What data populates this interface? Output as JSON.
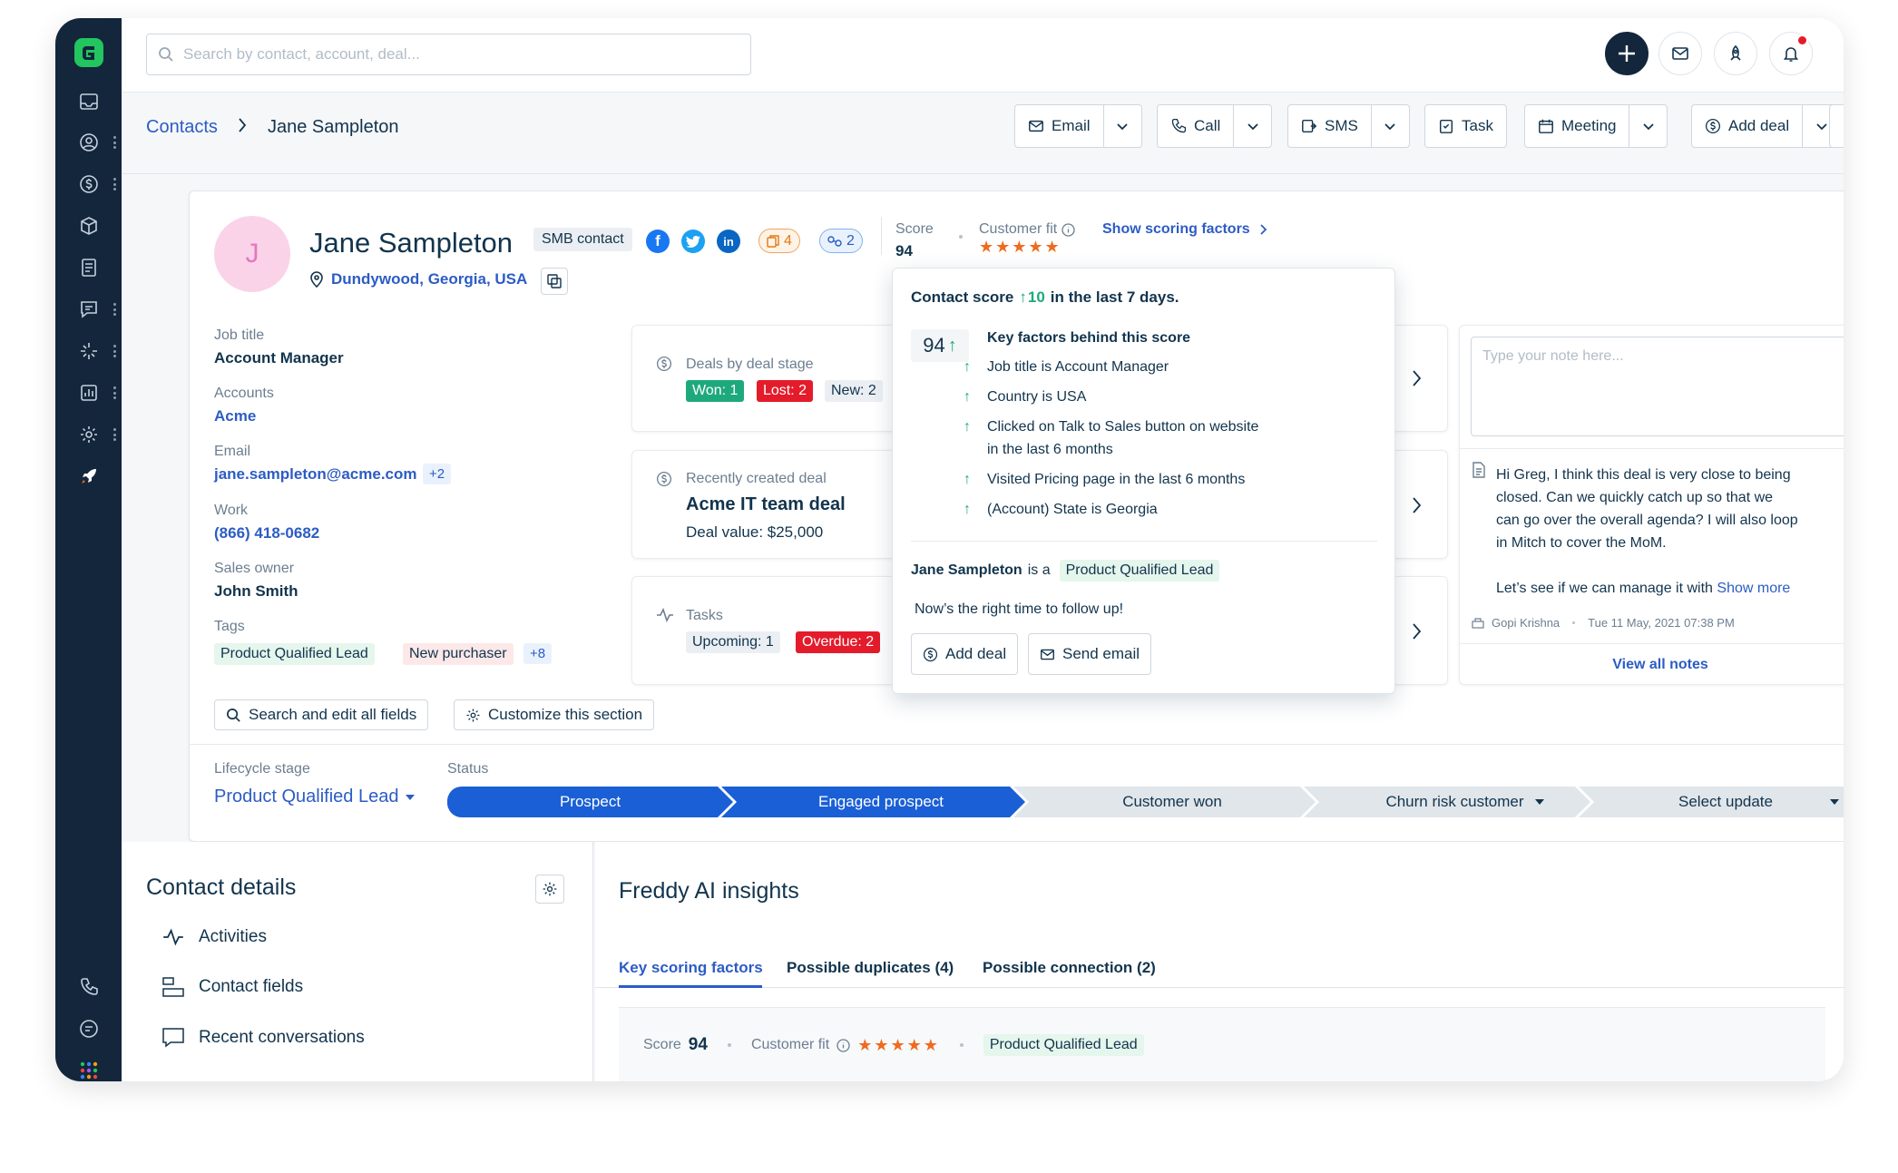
{
  "search": {
    "placeholder": "Search by contact, account, deal..."
  },
  "breadcrumb": {
    "parent": "Contacts",
    "current": "Jane Sampleton"
  },
  "actions": {
    "email": "Email",
    "call": "Call",
    "sms": "SMS",
    "task": "Task",
    "meeting": "Meeting",
    "add_deal": "Add deal"
  },
  "contact": {
    "initial": "J",
    "name": "Jane Sampleton",
    "type_badge": "SMB contact",
    "location": "Dundywood, Georgia, USA",
    "badge_files": "4",
    "badge_links": "2",
    "score_label": "Score",
    "score": "94",
    "fit_label": "Customer fit",
    "show_scoring": "Show scoring factors",
    "job_title_label": "Job title",
    "job_title": "Account Manager",
    "accounts_label": "Accounts",
    "account": "Acme",
    "email_label": "Email",
    "email": "jane.sampleton@acme.com",
    "email_more": "+2",
    "work_label": "Work",
    "work": "(866) 418-0682",
    "owner_label": "Sales owner",
    "owner": "John Smith",
    "tags_label": "Tags",
    "tags": [
      "Product Qualified Lead",
      "New purchaser"
    ],
    "tags_more": "+8",
    "search_fields": "Search and edit all fields",
    "customize": "Customize this section"
  },
  "deals_stage": {
    "label": "Deals by deal stage",
    "won": "Won: 1",
    "lost": "Lost: 2",
    "new": "New: 2"
  },
  "recent_deal": {
    "label": "Recently created deal",
    "name": "Acme IT team deal",
    "value": "Deal value: $25,000"
  },
  "tasks": {
    "label": "Tasks",
    "upcoming": "Upcoming: 1",
    "overdue": "Overdue: 2"
  },
  "popup": {
    "heading_pre": "Contact score",
    "heading_delta": "10",
    "heading_post": "in the last 7 days.",
    "score": "94",
    "factors_title": "Key factors behind this score",
    "factors": [
      "Job title is Account Manager",
      "Country is USA",
      "Clicked on Talk to Sales button on website",
      "in the last 6 months",
      "Visited Pricing page in the last 6 months",
      "(Account) State is Georgia"
    ],
    "lead_pre": "Jane Sampleton",
    "lead_mid": "is a",
    "lead_tag": "Product Qualified Lead",
    "advice": "Now’s the right time to follow up!",
    "add_deal": "Add deal",
    "send_email": "Send email"
  },
  "notes": {
    "placeholder": "Type your note here...",
    "lines": [
      "Hi Greg, I think this deal is very close to being",
      "closed. Can we quickly catch up so that we",
      "can go over the overall agenda? I will also loop",
      "in Mitch to cover the MoM."
    ],
    "line5": "Let’s see if we can manage it with",
    "show_more": "Show more",
    "author": "Gopi Krishna",
    "time": "Tue 11 May, 2021 07:38 PM",
    "view_all": "View all notes"
  },
  "lifecycle": {
    "label": "Lifecycle stage",
    "value": "Product Qualified Lead",
    "status_label": "Status",
    "stages": [
      "Prospect",
      "Engaged prospect",
      "Customer won",
      "Churn risk customer",
      "Select update"
    ]
  },
  "details": {
    "title": "Contact details",
    "items": [
      "Activities",
      "Contact fields",
      "Recent conversations"
    ]
  },
  "insights": {
    "title": "Freddy AI insights",
    "tabs": [
      "Key scoring factors",
      "Possible duplicates (4)",
      "Possible connection (2)"
    ],
    "score_label": "Score",
    "score": "94",
    "fit_label": "Customer fit",
    "lead_tag": "Product Qualified Lead"
  },
  "colors": {
    "brand": "#2c5cc5",
    "navy": "#13263c",
    "green": "#1ea97c",
    "red": "#e41b2a",
    "star": "#ef6b1e",
    "stage_active": "#1a5fd6"
  }
}
